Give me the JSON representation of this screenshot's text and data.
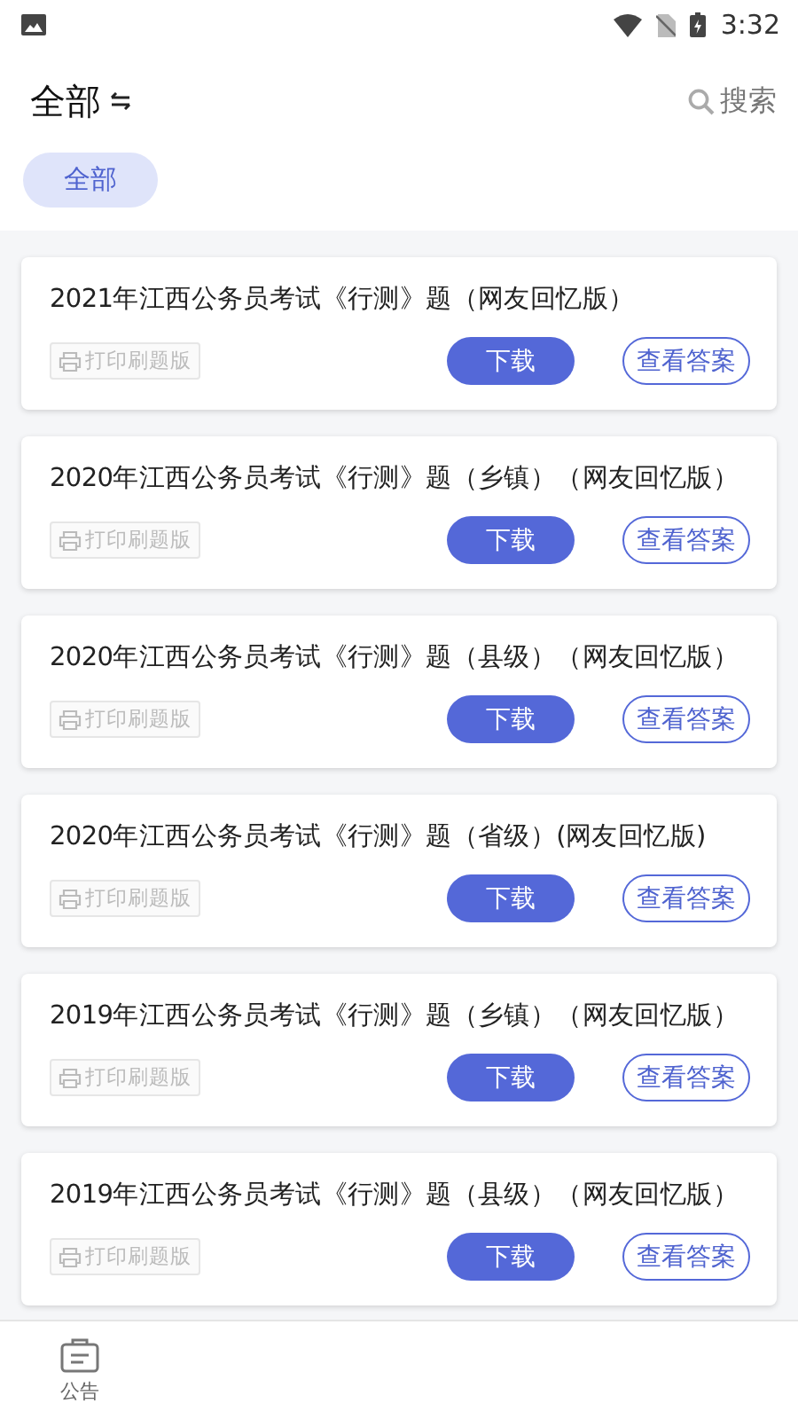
{
  "status_bar": {
    "time": "3:32"
  },
  "header": {
    "title": "全部",
    "search_label": "搜索"
  },
  "filters": [
    {
      "label": "全部",
      "selected": true
    }
  ],
  "papers": [
    {
      "title": "2021年江西公务员考试《行测》题（网友回忆版）",
      "print_label": "打印刷题版",
      "download_label": "下载",
      "answer_label": "查看答案"
    },
    {
      "title": "2020年江西公务员考试《行测》题（乡镇）（网友回忆版）",
      "print_label": "打印刷题版",
      "download_label": "下载",
      "answer_label": "查看答案"
    },
    {
      "title": "2020年江西公务员考试《行测》题（县级）（网友回忆版）",
      "print_label": "打印刷题版",
      "download_label": "下载",
      "answer_label": "查看答案"
    },
    {
      "title": "2020年江西公务员考试《行测》题（省级）(网友回忆版)",
      "print_label": "打印刷题版",
      "download_label": "下载",
      "answer_label": "查看答案"
    },
    {
      "title": "2019年江西公务员考试《行测》题（乡镇）（网友回忆版）",
      "print_label": "打印刷题版",
      "download_label": "下载",
      "answer_label": "查看答案"
    },
    {
      "title": "2019年江西公务员考试《行测》题（县级）（网友回忆版）",
      "print_label": "打印刷题版",
      "download_label": "下载",
      "answer_label": "查看答案"
    }
  ],
  "bottom_nav": [
    {
      "label": "公告"
    }
  ]
}
